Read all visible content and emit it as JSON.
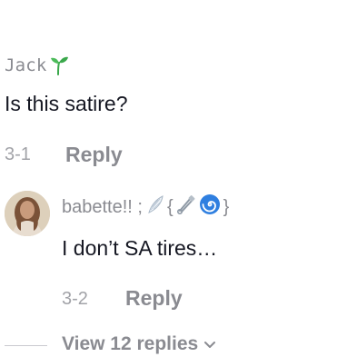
{
  "comments": [
    {
      "username": "Jack",
      "text": "Is this satire?",
      "date": "3-1",
      "reply_label": "Reply"
    },
    {
      "username": "babette!! ;",
      "username_brace_open": "{",
      "username_brace_close": "}",
      "text": "I don’t SA tires…",
      "date": "3-2",
      "reply_label": "Reply"
    }
  ],
  "view_replies_label": "View 12 replies",
  "colors": {
    "primary_text": "#161823",
    "secondary_text": "#8a8b91",
    "sprout_green": "#3aa84b",
    "spiral_blue": "#2f7fe0"
  },
  "icons": [
    "sprout-icon",
    "wing-icon",
    "safety-pin-icon",
    "spiral-icon",
    "chevron-down-icon"
  ]
}
